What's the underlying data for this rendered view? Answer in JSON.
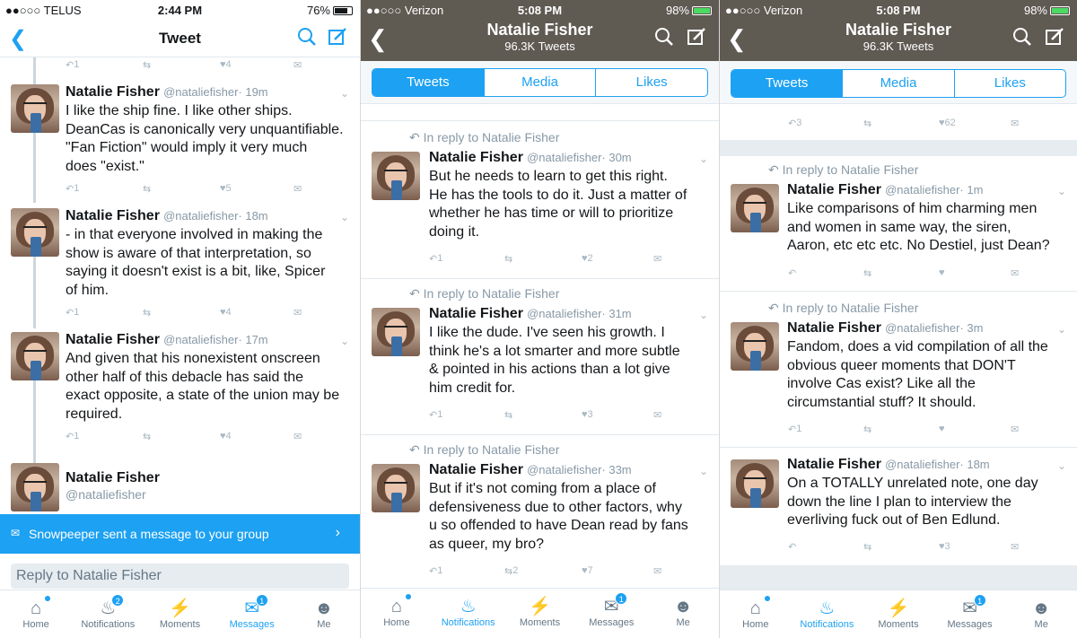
{
  "phone1": {
    "status": {
      "carrier": "●●○○○ TELUS",
      "time": "2:44 PM",
      "battery": "76%"
    },
    "nav_title": "Tweet",
    "top_counts": {
      "reply": "1",
      "like": "4"
    },
    "tweets": [
      {
        "name": "Natalie Fisher",
        "handle": "@nataliefisher",
        "time": "· 19m",
        "text": "I like the ship fine. I like other ships.\nDeanCas is canonically very unquantifiable.\n\"Fan Fiction\" would imply it very much\ndoes \"exist.\"",
        "reply_count": "1",
        "like_count": "5"
      },
      {
        "name": "Natalie Fisher",
        "handle": "@nataliefisher",
        "time": "· 18m",
        "text": "- in that everyone involved in making the\nshow is aware of that interpretation, so\nsaying it doesn't exist is a bit, like, Spicer\nof him.",
        "reply_count": "1",
        "like_count": "4"
      },
      {
        "name": "Natalie Fisher",
        "handle": "@nataliefisher",
        "time": "· 17m",
        "text": "And given that his nonexistent onscreen\nother half of this debacle has said the\nexact opposite, a state of the union may be\nrequired.",
        "reply_count": "1",
        "like_count": "4"
      }
    ],
    "compose_user": {
      "name": "Natalie Fisher",
      "handle": "@nataliefisher"
    },
    "banner": "Snowpeeper sent a message to your group",
    "reply_placeholder": "Reply to Natalie Fisher",
    "tabs": [
      {
        "label": "Home",
        "badge": ""
      },
      {
        "label": "Notifications",
        "badge": "2"
      },
      {
        "label": "Moments",
        "badge": ""
      },
      {
        "label": "Messages",
        "badge": "1"
      },
      {
        "label": "Me",
        "badge": ""
      }
    ]
  },
  "phone2": {
    "status": {
      "carrier": "●●○○○ Verizon",
      "time": "5:08 PM",
      "battery": "98%"
    },
    "profile_name": "Natalie Fisher",
    "tweet_count": "96.3K Tweets",
    "segments": [
      "Tweets",
      "Media",
      "Likes"
    ],
    "reply_label": "In reply to Natalie Fisher",
    "tweets": [
      {
        "name": "Natalie Fisher",
        "handle": "@nataliefisher",
        "time": "· 30m",
        "text": "But he needs to learn to get this right.\nHe has the tools to do it. Just a matter of\nwhether he has time or will to prioritize\ndoing it.",
        "reply_count": "1",
        "retweet_count": "",
        "like_count": "2"
      },
      {
        "name": "Natalie Fisher",
        "handle": "@nataliefisher",
        "time": "· 31m",
        "text": "I like the dude. I've seen his growth. I\nthink he's a lot smarter and more subtle\n& pointed in his actions than a lot give\nhim credit for.",
        "reply_count": "1",
        "retweet_count": "",
        "like_count": "3"
      },
      {
        "name": "Natalie Fisher",
        "handle": "@nataliefisher",
        "time": "· 33m",
        "text": "But if it's not coming from a place of\ndefensiveness due to other factors, why\nu so offended to have Dean read by fans\nas queer, my bro?",
        "reply_count": "1",
        "retweet_count": "2",
        "like_count": "7"
      }
    ],
    "tabs": [
      {
        "label": "Home",
        "badge": ""
      },
      {
        "label": "Notifications",
        "badge": ""
      },
      {
        "label": "Moments",
        "badge": ""
      },
      {
        "label": "Messages",
        "badge": "1"
      },
      {
        "label": "Me",
        "badge": ""
      }
    ]
  },
  "phone3": {
    "status": {
      "carrier": "●●○○○ Verizon",
      "time": "5:08 PM",
      "battery": "98%"
    },
    "profile_name": "Natalie Fisher",
    "tweet_count": "96.3K Tweets",
    "segments": [
      "Tweets",
      "Media",
      "Likes"
    ],
    "top_counts": {
      "reply": "3",
      "like": "62"
    },
    "reply_label": "In reply to Natalie Fisher",
    "tweets": [
      {
        "name": "Natalie Fisher",
        "handle": "@nataliefisher",
        "time": "· 1m",
        "text": "Like comparisons of him charming men\nand women in same way, the siren,\nAaron, etc etc etc. No Destiel, just Dean?",
        "reply_count": "",
        "like_count": ""
      },
      {
        "name": "Natalie Fisher",
        "handle": "@nataliefisher",
        "time": "· 3m",
        "text": "Fandom, does a vid compilation of all the\nobvious queer moments that DON'T\ninvolve Cas exist? Like all the\ncircumstantial stuff? It should.",
        "reply_count": "1",
        "like_count": ""
      },
      {
        "name": "Natalie Fisher",
        "handle": "@nataliefisher",
        "time": "· 18m",
        "text": "On a TOTALLY unrelated note, one day\ndown the line I plan to interview the\neverliving fuck out of Ben Edlund.",
        "reply_count": "",
        "like_count": "3"
      }
    ],
    "tabs": [
      {
        "label": "Home",
        "badge": ""
      },
      {
        "label": "Notifications",
        "badge": ""
      },
      {
        "label": "Moments",
        "badge": ""
      },
      {
        "label": "Messages",
        "badge": "1"
      },
      {
        "label": "Me",
        "badge": ""
      }
    ]
  },
  "icons": {
    "reply": "reply-icon",
    "retweet": "retweet-icon",
    "like": "heart-icon",
    "dm": "envelope-icon",
    "search": "search-icon",
    "compose": "compose-icon",
    "back": "back-chevron-icon"
  },
  "colors": {
    "accent": "#1da1f2",
    "header_dark": "#5f5a52"
  }
}
